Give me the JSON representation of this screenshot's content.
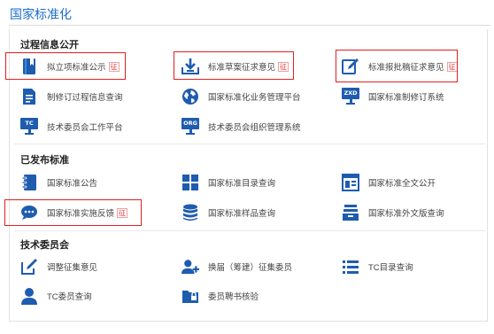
{
  "header": {
    "title": "国家标准化"
  },
  "sections": [
    {
      "title": "过程信息公开",
      "items": [
        {
          "label": "拟立项标准公示",
          "badge": "征",
          "icon": "bookmark-book-icon"
        },
        {
          "label": "标准草案征求意见",
          "badge": "征",
          "icon": "download-tray-icon"
        },
        {
          "label": "标准报批稿征求意见",
          "badge": "征",
          "icon": "edit-form-icon"
        },
        {
          "label": "制修订过程信息查询",
          "icon": "document-list-icon"
        },
        {
          "label": "国家标准化业务管理平台",
          "icon": "globe-icon"
        },
        {
          "label": "国家标准制修订系统",
          "icon": "zxd-monitor-icon",
          "tag": "ZXD"
        },
        {
          "label": "技术委员会工作平台",
          "icon": "tc-monitor-icon",
          "tag": "TC"
        },
        {
          "label": "技术委员会组织管理系统",
          "icon": "org-monitor-icon",
          "tag": "ORG"
        }
      ]
    },
    {
      "title": "已发布标准",
      "items": [
        {
          "label": "国家标准公告",
          "icon": "notebook-icon"
        },
        {
          "label": "国家标准目录查询",
          "icon": "grid-icon"
        },
        {
          "label": "国家标准全文公开",
          "icon": "layout-window-icon"
        },
        {
          "label": "国家标准实施反馈",
          "badge": "征",
          "icon": "chat-bubble-icon"
        },
        {
          "label": "国家标准样品查询",
          "icon": "database-icon"
        },
        {
          "label": "国家标准外文版查询",
          "icon": "stack-tray-icon"
        }
      ]
    },
    {
      "title": "技术委员会",
      "items": [
        {
          "label": "调整征集意见",
          "icon": "pencil-note-icon"
        },
        {
          "label": "换届（筹建）征集委员",
          "icon": "user-add-icon"
        },
        {
          "label": "TC目录查询",
          "icon": "list-icon"
        },
        {
          "label": "TC委员查询",
          "icon": "user-icon"
        },
        {
          "label": "委员聘书核验",
          "icon": "folder-lock-icon"
        }
      ]
    }
  ],
  "colors": {
    "accent": "#1e6fc9",
    "icon": "#1e5cae",
    "highlight": "#e02020",
    "badge": "#e03b3b"
  }
}
